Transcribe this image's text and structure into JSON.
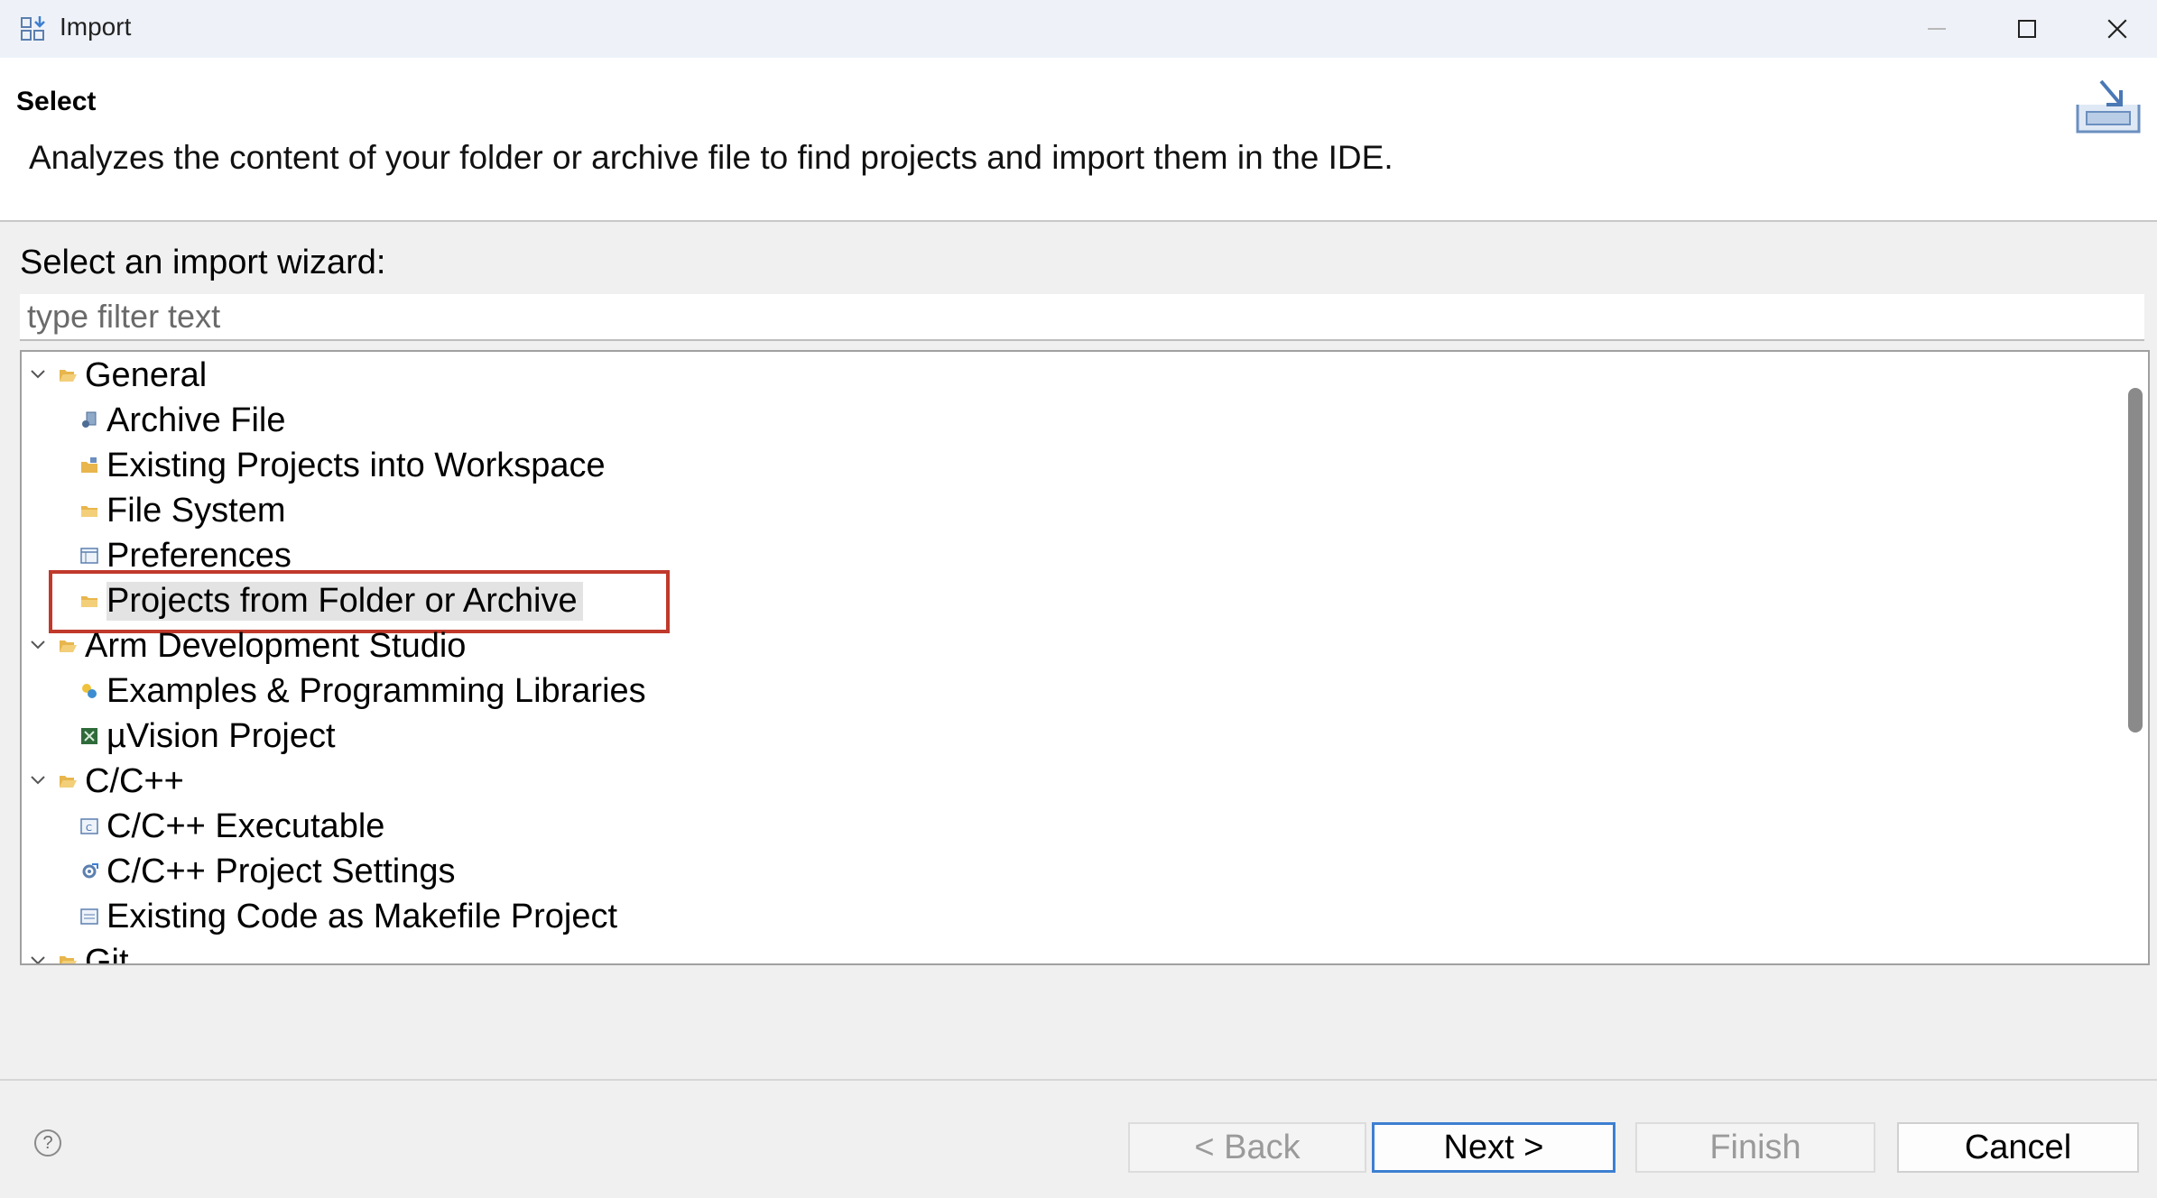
{
  "window": {
    "title": "Import",
    "icon": "import-wizard-icon",
    "controls": [
      "minimize-icon",
      "maximize-icon",
      "close-icon"
    ]
  },
  "header": {
    "title": "Select",
    "description": "Analyzes the content of your folder or archive file to find projects and import them in the IDE.",
    "icon": "import-banner-icon"
  },
  "wizard": {
    "prompt": "Select an import wizard:",
    "filter_placeholder": "type filter text",
    "tree": [
      {
        "label": "General",
        "type": "category",
        "expanded": true,
        "icon": "folder-open-icon"
      },
      {
        "label": "Archive File",
        "type": "item",
        "icon": "archive-file-icon"
      },
      {
        "label": "Existing Projects into Workspace",
        "type": "item",
        "icon": "project-folder-icon"
      },
      {
        "label": "File System",
        "type": "item",
        "icon": "folder-icon"
      },
      {
        "label": "Preferences",
        "type": "item",
        "icon": "preferences-icon"
      },
      {
        "label": "Projects from Folder or Archive",
        "type": "item",
        "selected": true,
        "icon": "folder-icon"
      },
      {
        "label": "Arm Development Studio",
        "type": "category",
        "expanded": true,
        "icon": "folder-open-icon"
      },
      {
        "label": "Examples & Programming Libraries",
        "type": "item",
        "icon": "examples-icon"
      },
      {
        "label": "µVision Project",
        "type": "item",
        "icon": "uvision-icon"
      },
      {
        "label": "C/C++",
        "type": "category",
        "expanded": true,
        "icon": "folder-open-icon"
      },
      {
        "label": "C/C++ Executable",
        "type": "item",
        "icon": "executable-icon"
      },
      {
        "label": "C/C++ Project Settings",
        "type": "item",
        "icon": "settings-icon"
      },
      {
        "label": "Existing Code as Makefile Project",
        "type": "item",
        "icon": "makefile-icon"
      },
      {
        "label": "Git",
        "type": "category",
        "expanded": true,
        "icon": "folder-open-icon"
      }
    ]
  },
  "footer": {
    "help": "?",
    "back": "< Back",
    "next": "Next >",
    "finish": "Finish",
    "cancel": "Cancel"
  },
  "colors": {
    "highlight": "#c0392b",
    "default_button_border": "#3d7fd1",
    "folder": "#e8b64c"
  }
}
